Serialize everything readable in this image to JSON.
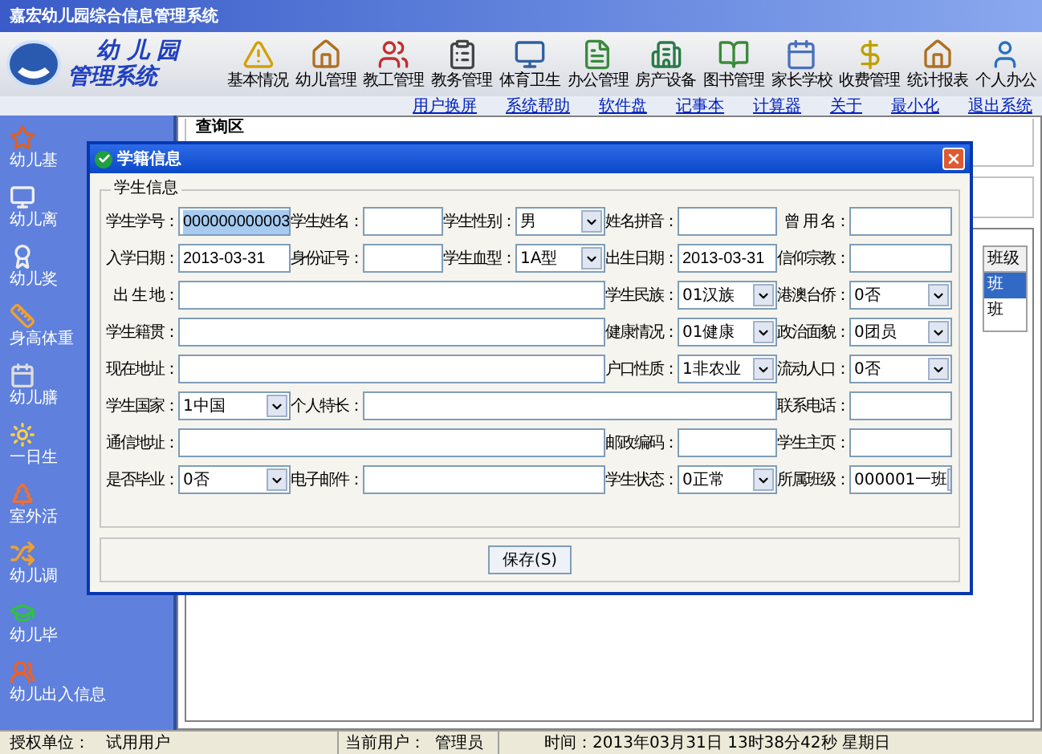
{
  "window": {
    "title": "嘉宏幼儿园综合信息管理系统"
  },
  "logo": {
    "line1": "幼 儿 园",
    "line2": "管理系统"
  },
  "toolbar": [
    {
      "label": "基本情况"
    },
    {
      "label": "幼儿管理"
    },
    {
      "label": "教工管理"
    },
    {
      "label": "教务管理"
    },
    {
      "label": "体育卫生"
    },
    {
      "label": "办公管理"
    },
    {
      "label": "房产设备"
    },
    {
      "label": "图书管理"
    },
    {
      "label": "家长学校"
    },
    {
      "label": "收费管理"
    },
    {
      "label": "统计报表"
    },
    {
      "label": "个人办公"
    }
  ],
  "links": [
    "用户换屏",
    "系统帮助",
    "软件盘",
    "记事本",
    "计算器",
    "关于",
    "最小化",
    "退出系统"
  ],
  "sidebar": {
    "items": [
      {
        "label": "幼儿基"
      },
      {
        "label": "幼儿离"
      },
      {
        "label": "幼儿奖"
      },
      {
        "label": "身高体重"
      },
      {
        "label": "幼儿膳"
      },
      {
        "label": "一日生"
      },
      {
        "label": "室外活"
      },
      {
        "label": "幼儿调"
      },
      {
        "label": "幼儿毕"
      },
      {
        "label": "幼儿出入信息"
      }
    ]
  },
  "query_area": {
    "title": "查询区"
  },
  "class_list": {
    "header": "班级",
    "rows": [
      {
        "text": "班",
        "selected": true
      },
      {
        "text": "班",
        "selected": false
      }
    ]
  },
  "dialog": {
    "title": "学籍信息",
    "group_title": "学生信息",
    "save_button": "保存(S)",
    "rows": [
      [
        {
          "label": "学生学号：",
          "kind": "text",
          "value": "000000000003",
          "focused": true
        },
        {
          "label": "学生姓名：",
          "kind": "text",
          "focused": false
        },
        {
          "label": "学生性别：",
          "kind": "select",
          "value": "男",
          "focused": false
        },
        {
          "label": "姓名拼音：",
          "kind": "text",
          "focused": false
        },
        {
          "label": "曾 用 名：",
          "kind": "text",
          "focused": false
        }
      ],
      [
        {
          "label": "入学日期：",
          "kind": "text",
          "value": "2013-03-31",
          "focused": false
        },
        {
          "label": "身份证号：",
          "kind": "text",
          "focused": false
        },
        {
          "label": "学生血型：",
          "kind": "select",
          "value": "1A型",
          "focused": false
        },
        {
          "label": "出生日期：",
          "kind": "text",
          "value": "2013-03-31",
          "focused": false
        },
        {
          "label": "信仰宗教：",
          "kind": "text",
          "focused": false
        }
      ],
      [
        {
          "label": "出 生 地：",
          "kind": "text",
          "focused": false
        },
        {
          "label": "学生民族：",
          "kind": "select",
          "value": "01汉族",
          "focused": false
        },
        {
          "label": "港澳台侨：",
          "kind": "select",
          "value": "0否",
          "focused": false
        }
      ],
      [
        {
          "label": "学生籍贯：",
          "kind": "text",
          "focused": false
        },
        {
          "label": "健康情况：",
          "kind": "select",
          "value": "01健康",
          "focused": false
        },
        {
          "label": "政治面貌：",
          "kind": "select",
          "value": "0团员",
          "focused": false
        }
      ],
      [
        {
          "label": "现在地址：",
          "kind": "text",
          "focused": false
        },
        {
          "label": "户口性质：",
          "kind": "select",
          "value": "1非农业",
          "focused": false
        },
        {
          "label": "流动人口：",
          "kind": "select",
          "value": "0否",
          "focused": false
        }
      ],
      [
        {
          "label": "学生国家：",
          "kind": "select",
          "value": "1中国",
          "focused": false
        },
        {
          "label": "个人特长：",
          "kind": "text",
          "focused": false
        },
        {
          "label": "联系电话：",
          "kind": "text",
          "focused": false
        }
      ],
      [
        {
          "label": "通信地址：",
          "kind": "text",
          "focused": false
        },
        {
          "label": "邮政编码：",
          "kind": "text",
          "focused": false
        },
        {
          "label": "学生主页：",
          "kind": "text",
          "focused": false
        }
      ],
      [
        {
          "label": "是否毕业：",
          "kind": "select",
          "value": "0否",
          "focused": false
        },
        {
          "label": "电子邮件：",
          "kind": "text",
          "focused": false
        },
        "",
        {
          "label": "学生状态：",
          "kind": "select",
          "value": "0正常",
          "focused": false
        },
        {
          "label": "所属班级：",
          "kind": "select",
          "value": "000001一班",
          "focused": false
        }
      ]
    ]
  },
  "status_bar": {
    "unit_label": "授权单位：",
    "unit": "试用用户",
    "user_label": "当前用户：",
    "user": "管理员",
    "time": "时间：2013年03月31日 13时38分42秒 星期日"
  }
}
